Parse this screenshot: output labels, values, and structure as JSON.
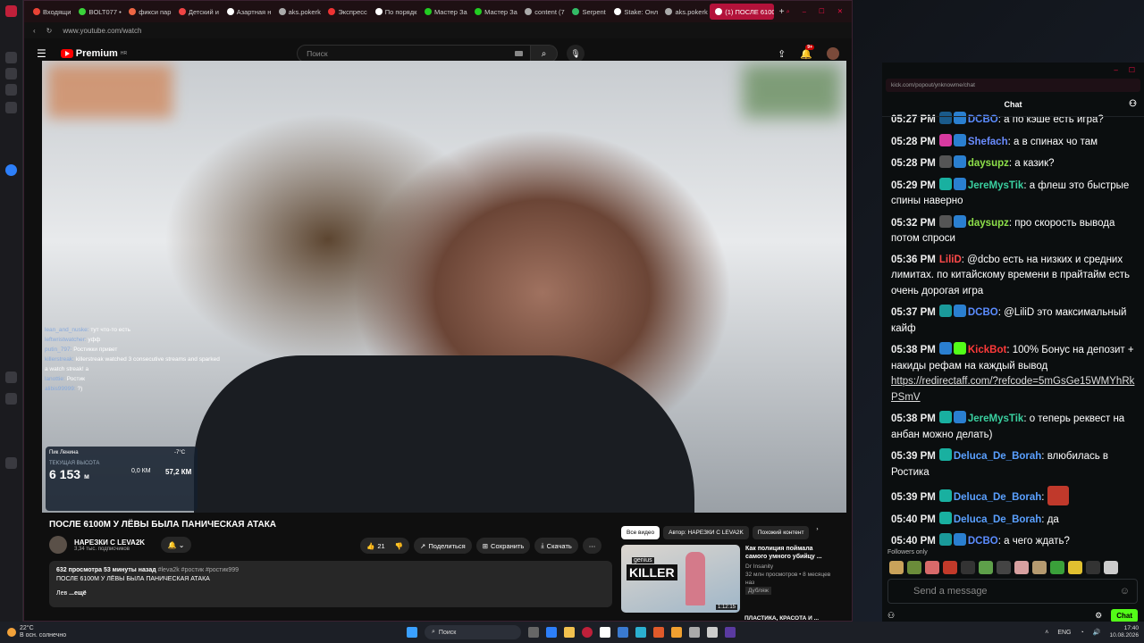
{
  "browser": {
    "tabs": [
      {
        "label": "Входящи",
        "color": "#ea4335"
      },
      {
        "label": "BOLT077 •",
        "color": "#3ad33a"
      },
      {
        "label": "фикси пар",
        "color": "#e64"
      },
      {
        "label": "Детский и",
        "color": "#e44"
      },
      {
        "label": "Азартная н",
        "color": "#fff"
      },
      {
        "label": "aks.pokerk",
        "color": "#aaa"
      },
      {
        "label": "Экспресс",
        "color": "#e33"
      },
      {
        "label": "По порядк",
        "color": "#fff"
      },
      {
        "label": "Мастер За",
        "color": "#2c2"
      },
      {
        "label": "Мастер За",
        "color": "#2c2"
      },
      {
        "label": "content (7",
        "color": "#aaa"
      },
      {
        "label": "Serpent",
        "color": "#3b6"
      },
      {
        "label": "Stake: Онл",
        "color": "#fff"
      },
      {
        "label": "aks.pokerk",
        "color": "#aaa"
      }
    ],
    "active_tab": "(1) ПОСЛЕ 6100",
    "url": "www.youtube.com/watch"
  },
  "youtube": {
    "logo": "Premium",
    "logo_region": "HR",
    "search_placeholder": "Поиск",
    "notif_count": "9+",
    "video": {
      "overlay_chat": [
        {
          "name": "lean_and_nuske:",
          "text": "тут что-то есть"
        },
        {
          "name": "leftwristwatcher:",
          "text": "уфф"
        },
        {
          "name": "putin_797:",
          "text": "Ростикки привет"
        },
        {
          "name": "killerstreak:",
          "text": "killerstreak watched 3 consecutive streams and sparked a watch streak! a"
        },
        {
          "name": "lanottie:",
          "text": "Ростик"
        },
        {
          "name": "alibis99999:",
          "text": "?)"
        }
      ],
      "hud": {
        "place": "Пик Ленина",
        "altitude_label": "ТЕКУЩАЯ ВЫСОТА",
        "altitude": "6 153",
        "altitude_unit": "м",
        "speed": "0,0 КМ",
        "distance": "57,2 КМ",
        "temp": "-7°C"
      }
    },
    "title": "ПОСЛЕ 6100М У ЛЁВЫ БЫЛА ПАНИЧЕСКАЯ АТАКА",
    "channel": {
      "name": "НАРЕЗКИ С LEVA2K",
      "subs": "3,34 тыс. подписчиков"
    },
    "actions": {
      "likes": "21",
      "share": "Поделиться",
      "save": "Сохранить",
      "download": "Скачать"
    },
    "description": {
      "views": "632 просмотра",
      "age": "53 минуты назад",
      "tags": "#leva2k #ростик #ростик999",
      "line1": "ПОСЛЕ 6100М У ЛЁВЫ БЫЛА ПАНИЧЕСКАЯ АТАКА",
      "line2": "Лев",
      "more": "...ещё"
    },
    "chips": [
      "Все видео",
      "Автор: НАРЕЗКИ С LEVA2K",
      "Похожий контент"
    ],
    "recommended": [
      {
        "title": "Как полиция поймала самого умного убийцу ...",
        "channel": "Dr Insanity",
        "meta": "32 млн просмотров • 8 месяцев наз",
        "badge": "Дубляж",
        "duration": "1:12:15",
        "thumb_text": "KILLER",
        "thumb_small": "genius"
      }
    ],
    "recommended_next": "ПЛАСТИКА, КРАСОТА И ..."
  },
  "kick": {
    "url": "kick.com/popout/ynknowme/chat",
    "title": "Chat",
    "messages": [
      {
        "time": "05:27 PM",
        "user": "DCBO",
        "color": "#5b8cff",
        "text": "а по кэше есть игра?",
        "badges": [
          "#1a5a8a",
          "#2a7fd0"
        ]
      },
      {
        "time": "05:28 PM",
        "user": "Shefach",
        "color": "#6a8cff",
        "text": "а в спинах чо там",
        "badges": [
          "#d83aa0",
          "#2a7fd0"
        ]
      },
      {
        "time": "05:28 PM",
        "user": "daysupz",
        "color": "#8ee04a",
        "text": "а казик?",
        "badges": [
          "#555",
          "#2a7fd0"
        ]
      },
      {
        "time": "05:29 PM",
        "user": "JereMysTik",
        "color": "#3ad0a0",
        "text": "а флеш это быстрые спины наверно",
        "badges": [
          "#19b0a0",
          "#2a7fd0"
        ]
      },
      {
        "time": "05:32 PM",
        "user": "daysupz",
        "color": "#8ee04a",
        "text": "про скорость вывода потом спроси",
        "badges": [
          "#555",
          "#2a7fd0"
        ]
      },
      {
        "time": "05:36 PM",
        "user": "LiliD",
        "color": "#ff4a4a",
        "text": "@dcbo есть на низких и средних лимитах. по китайскому времени в прайтайм есть очень дорогая игра",
        "badges": []
      },
      {
        "time": "05:37 PM",
        "user": "DCBO",
        "color": "#5b8cff",
        "text": "@LiliD это максимальный кайф",
        "badges": [
          "#1a9a9a",
          "#2a7fd0"
        ]
      },
      {
        "time": "05:38 PM",
        "user": "KickBot",
        "color": "#ff3a3a",
        "text": "100% Бонус на депозит + накиды рефам на каждый вывод",
        "link": "https://redirectaff.com/?refcode=5mGsGe15WMYhRkPSmV",
        "badges": [
          "#2a7fd0",
          "#53fc18"
        ]
      },
      {
        "time": "05:38 PM",
        "user": "JereMysTik",
        "color": "#3ad0a0",
        "text": "о теперь реквест на анбан можно делать)",
        "badges": [
          "#19b0a0",
          "#2a7fd0"
        ]
      },
      {
        "time": "05:39 PM",
        "user": "Deluca_De_Borah",
        "color": "#5aa0ff",
        "text": "влюбилась в Ростика",
        "badges": [
          "#19b0a0"
        ]
      },
      {
        "time": "05:39 PM",
        "user": "Deluca_De_Borah",
        "color": "#5aa0ff",
        "text": "",
        "badges": [
          "#19b0a0"
        ],
        "emote": true
      },
      {
        "time": "05:40 PM",
        "user": "Deluca_De_Borah",
        "color": "#5aa0ff",
        "text": "да",
        "badges": [
          "#19b0a0"
        ]
      },
      {
        "time": "05:40 PM",
        "user": "DCBO",
        "color": "#5b8cff",
        "text": "а чего ждать?",
        "badges": [
          "#1a9a9a",
          "#2a7fd0"
        ]
      }
    ],
    "followers_only": "Followers only",
    "send_placeholder": "Send a message",
    "chat_button": "Chat"
  },
  "taskbar": {
    "temp": "22°C",
    "weather": "В осн. солнечно",
    "search": "Поиск",
    "lang": "ENG",
    "time": "17:40",
    "date": "10.08.2026"
  }
}
